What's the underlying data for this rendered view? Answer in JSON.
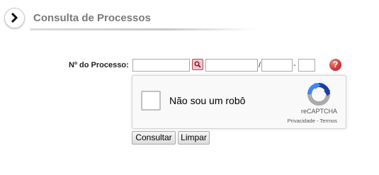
{
  "header": {
    "title": "Consulta de Processos",
    "arrow_icon": "chevron-right-icon"
  },
  "form": {
    "label": "Nº do Processo:",
    "separator_slash": "/",
    "separator_dash": "-",
    "search_icon": "search-icon",
    "help_icon": "?"
  },
  "recaptcha": {
    "label": "Não sou um robô",
    "brand": "reCAPTCHA",
    "privacy": "Privacidade",
    "links_sep": " - ",
    "terms": "Termos"
  },
  "buttons": {
    "consultar": "Consultar",
    "limpar": "Limpar"
  },
  "colors": {
    "title": "#7a7a7a",
    "search_button_bg": "#f4c6cc",
    "help_icon": "#d23a3a"
  }
}
